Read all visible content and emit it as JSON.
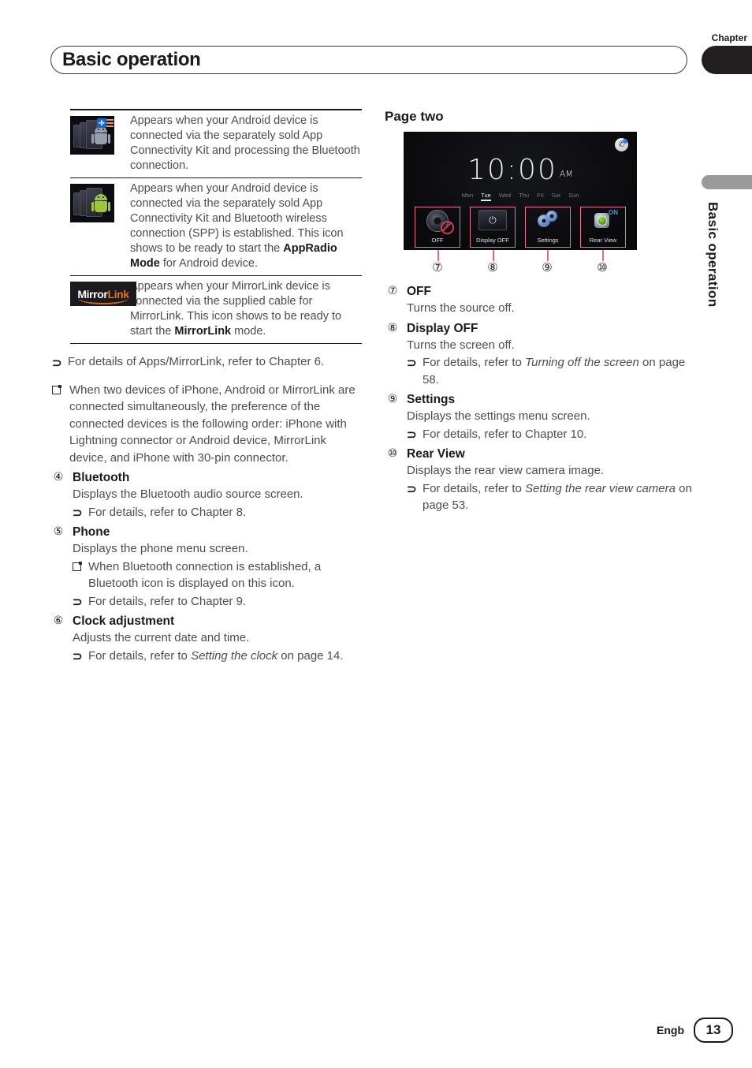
{
  "header": {
    "title": "Basic operation",
    "chapter_label": "Chapter",
    "side_tab_text": "Basic operation"
  },
  "icon_table": {
    "rows": [
      {
        "icon_name": "android-bluetooth-processing-icon",
        "description_lead": "Appears when your Android device is connected via the separately sold App Connectivity Kit and processing the Bluetooth connection."
      },
      {
        "icon_name": "android-spp-established-icon",
        "description_lead": "Appears when your Android device is connected via the separately sold App Connectivity Kit and Bluetooth wireless connection (SPP) is established.",
        "description_tail_pre": "This icon shows to be ready to start the ",
        "description_bold": "AppRadio Mode",
        "description_tail_post": " for Android device."
      },
      {
        "icon_name": "mirrorlink-logo-icon",
        "logo_text_primary": "Mirror",
        "logo_text_accent": "Link",
        "description_lead": "Appears when your MirrorLink device is connected via the supplied cable for MirrorLink. This icon shows to be ready to start the ",
        "description_bold": "MirrorLink",
        "description_tail_post": " mode."
      }
    ]
  },
  "left_column": {
    "apps_note": {
      "arrow": "⊃",
      "text": "For details of Apps/MirrorLink, refer  to Chapter 6."
    },
    "preference_note": {
      "text": "When two devices of  iPhone, Android or MirrorLink are connected simultaneously, the preference of the connected devices is the following order:  iPhone with Lightning connector or Android device, MirrorLink device, and iPhone with 30-pin connector."
    },
    "items": [
      {
        "number": "④",
        "title": "Bluetooth",
        "body": "Displays the Bluetooth audio source screen.",
        "refs": [
          {
            "arrow": "⊃",
            "text": "For details, refer to Chapter 8."
          }
        ]
      },
      {
        "number": "⑤",
        "title": "Phone",
        "body": "Displays the phone menu screen.",
        "square_note": "When Bluetooth connection is established,  a Bluetooth icon is displayed on this icon.",
        "refs": [
          {
            "arrow": "⊃",
            "text": "For details, refer to Chapter 9."
          }
        ]
      },
      {
        "number": "⑥",
        "title": "Clock adjustment",
        "body": "Adjusts the current date and time.",
        "refs": [
          {
            "arrow": "⊃",
            "text_pre": "For details, refer to ",
            "italic": "Setting the clock",
            "text_post": " on page 14."
          }
        ]
      }
    ]
  },
  "right_column": {
    "section_title": "Page two",
    "device_screen": {
      "status_icon_name": "bluetooth-phone-status-icon",
      "time": "10:00",
      "meridiem": "AM",
      "days": [
        "Mon",
        "Tue",
        "Wed",
        "Thu",
        "Fri",
        "Sat",
        "Sun"
      ],
      "active_day": "Tue",
      "buttons": [
        {
          "icon_name": "source-off-icon",
          "label": "OFF"
        },
        {
          "icon_name": "display-off-icon",
          "label": "Display OFF"
        },
        {
          "icon_name": "settings-gear-icon",
          "label": "Settings"
        },
        {
          "icon_name": "rear-view-camera-icon",
          "label": "Rear View",
          "badge": "ON"
        }
      ],
      "callout_color": "#e06a82"
    },
    "callout_numbers": [
      "⑦",
      "⑧",
      "⑨",
      "⑩"
    ],
    "items": [
      {
        "number": "⑦",
        "title": "OFF",
        "body": "Turns the source off.",
        "refs": []
      },
      {
        "number": "⑧",
        "title": "Display OFF",
        "body": "Turns the screen off.",
        "refs": [
          {
            "arrow": "⊃",
            "text_pre": "For details, refer to ",
            "italic": "Turning off the screen",
            "text_post": " on page 58."
          }
        ]
      },
      {
        "number": "⑨",
        "title": "Settings",
        "body": "Displays the settings menu screen.",
        "refs": [
          {
            "arrow": "⊃",
            "text": "For details, refer to Chapter 10."
          }
        ]
      },
      {
        "number": "⑩",
        "title": "Rear View",
        "body": "Displays the rear view camera image.",
        "refs": [
          {
            "arrow": "⊃",
            "text_pre": "For details, refer to ",
            "italic": "Setting the rear view camera",
            "text_post": " on page 53."
          }
        ]
      }
    ]
  },
  "footer": {
    "language": "Engb",
    "page_number": "13"
  }
}
